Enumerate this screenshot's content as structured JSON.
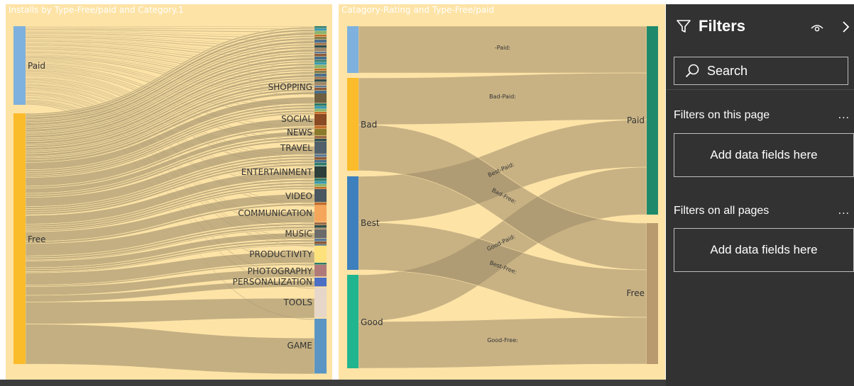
{
  "visual1": {
    "title": "Installs by Type-Free/paid and Category.1",
    "sources": [
      {
        "label": "Paid",
        "color": "#7eb1dd"
      },
      {
        "label": "Free",
        "color": "#fbbc2b"
      }
    ],
    "targets": [
      {
        "label": "SHOPPING",
        "color": "#6d5f3f"
      },
      {
        "label": "SOCIAL",
        "color": "#8a4a23"
      },
      {
        "label": "NEWS",
        "color": "#8b7a2c"
      },
      {
        "label": "TRAVEL",
        "color": "#51606b"
      },
      {
        "label": "ENTERTAINMENT",
        "color": "#2c3f3a"
      },
      {
        "label": "VIDEO",
        "color": "#4a5660"
      },
      {
        "label": "COMMUNICATION",
        "color": "#f5a65b"
      },
      {
        "label": "MUSIC",
        "color": "#6b6b6b"
      },
      {
        "label": "PRODUCTIVITY",
        "color": "#fde27c"
      },
      {
        "label": "PHOTOGRAPHY",
        "color": "#b07a7a"
      },
      {
        "label": "PERSONALIZATION",
        "color": "#4b6fc5"
      },
      {
        "label": "TOOLS",
        "color": "#e7d7c8"
      },
      {
        "label": "GAME",
        "color": "#5b95c4"
      }
    ]
  },
  "visual2": {
    "title": "Catagory-Rating and Type-Free/paid",
    "sources": [
      {
        "label": "",
        "color": "#7eb1dd"
      },
      {
        "label": "Bad",
        "color": "#fbbc2b"
      },
      {
        "label": "Best",
        "color": "#3e7fbd"
      },
      {
        "label": "Good",
        "color": "#21b58f"
      }
    ],
    "targets": [
      {
        "label": "Paid",
        "color": "#1f8a6b"
      },
      {
        "label": "Free",
        "color": "#b89a6e"
      }
    ],
    "link_labels": [
      "-Paid:",
      "Bad-Paid:",
      "Best-Paid:",
      "Bad-Free:",
      "Good-Paid:",
      "Best-Free:",
      "Good-Free:"
    ]
  },
  "filters": {
    "title": "Filters",
    "search_placeholder": "Search",
    "this_page_label": "Filters on this page",
    "all_pages_label": "Filters on all pages",
    "add_fields_label": "Add data fields here",
    "more_label": "..."
  }
}
